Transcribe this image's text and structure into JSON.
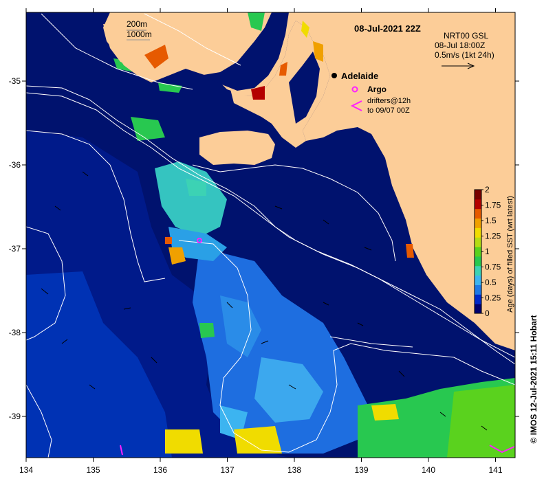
{
  "map": {
    "title": "08-Jul-2021 22Z",
    "bathymetry_legend": [
      "200m",
      "1000m"
    ],
    "product": {
      "line1": "NRT00 GSL",
      "line2": "08-Jul 18:00Z",
      "line3": "0.5m/s (1kt 24h)"
    },
    "city": {
      "name": "Adelaide",
      "lon": 138.6,
      "lat": -34.92
    },
    "argo": {
      "label": "Argo",
      "lon": 136.55,
      "lat": -36.92
    },
    "drifters": {
      "line1": "drifters@12h",
      "line2": "to 09/07 00Z"
    },
    "credit": "© IMOS 12-Jul-2021 15:11 Hobart",
    "x_ticks": [
      "134",
      "135",
      "136",
      "137",
      "138",
      "139",
      "140",
      "141"
    ],
    "y_ticks": [
      "-35",
      "-36",
      "-37",
      "-38",
      "-39"
    ]
  },
  "colorbar": {
    "label": "Age (days) of filled SST (wrt latest)",
    "ticks": [
      "2",
      "1.75",
      "1.5",
      "1.25",
      "1",
      "0.75",
      "0.5",
      "0.25",
      "0"
    ],
    "colors": [
      "#00006e",
      "#0028c8",
      "#1e78e6",
      "#3cb4f0",
      "#3cd2b4",
      "#28c850",
      "#5ad21e",
      "#b4dc14",
      "#f0dc00",
      "#f0a000",
      "#e65a00",
      "#b40000",
      "#780000"
    ]
  },
  "colors": {
    "land": "#fccd98",
    "ocean_deep": "#00126e",
    "white_contour": "#ffffff"
  }
}
